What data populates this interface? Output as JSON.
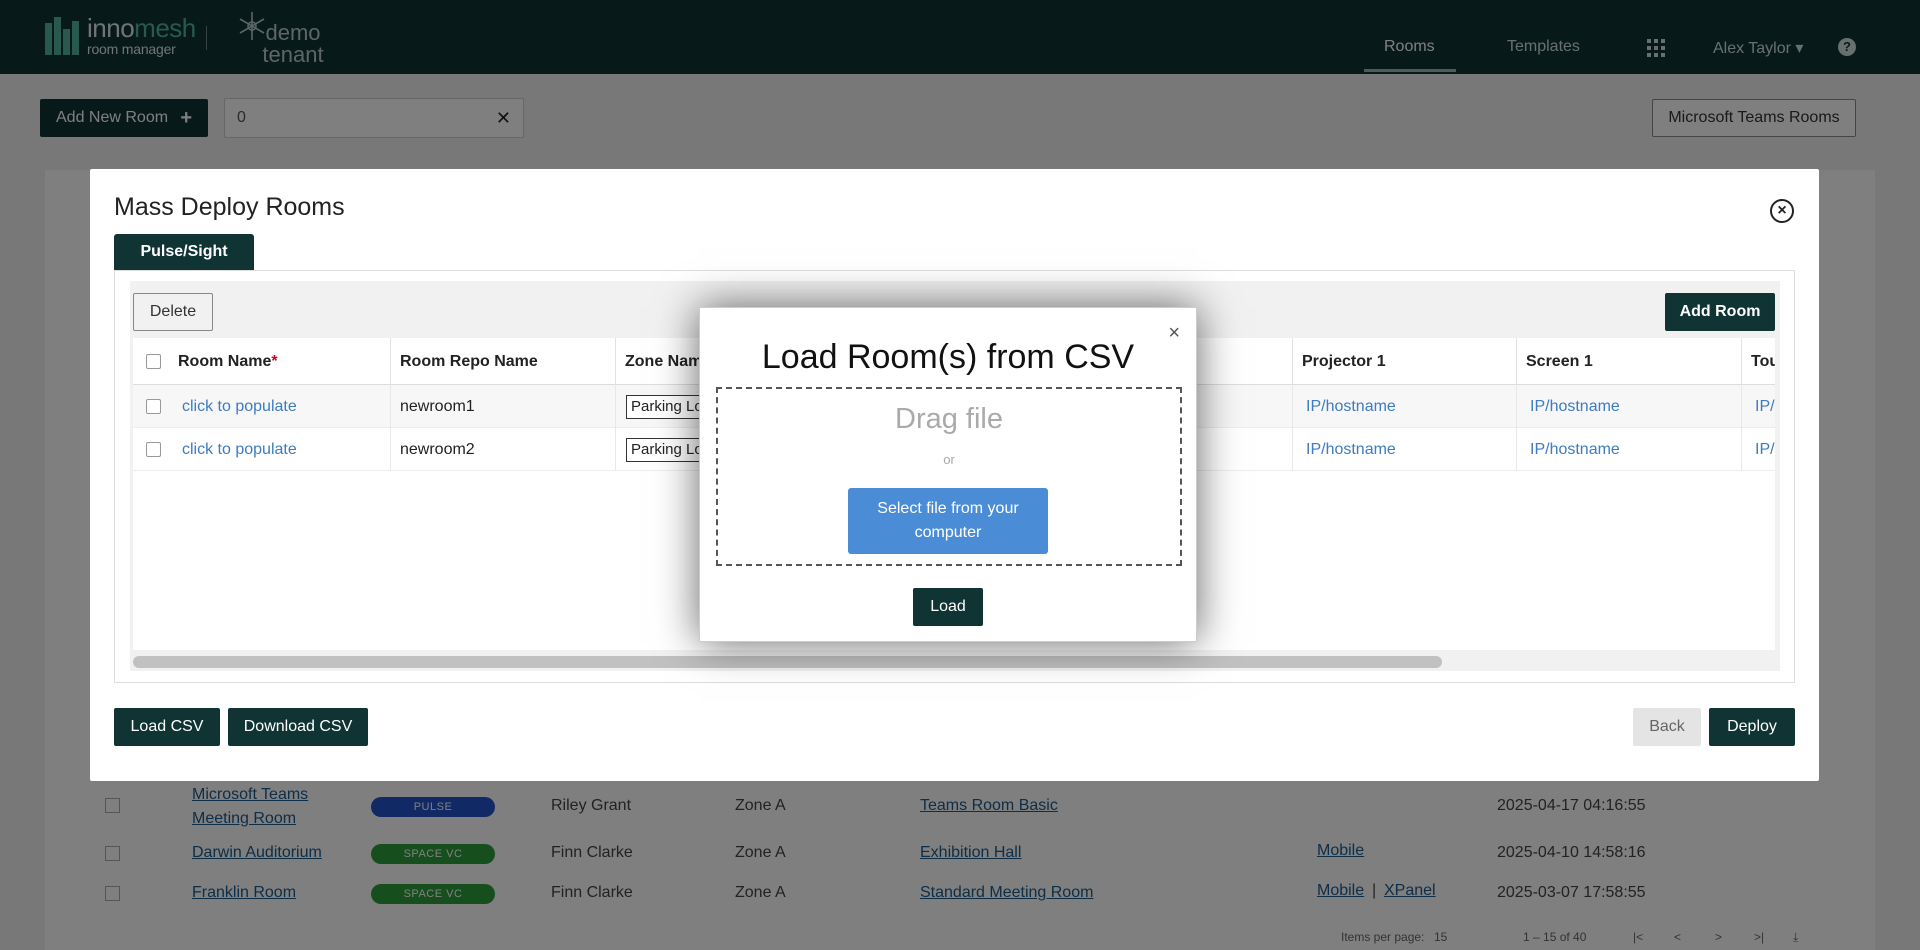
{
  "header": {
    "logo_name_1": "inno",
    "logo_name_2": "mesh",
    "logo_sub": "room manager",
    "tenant": "demo tenant",
    "nav": [
      {
        "label": "Rooms"
      },
      {
        "label": "Templates"
      }
    ],
    "user": "Alex Taylor ▾",
    "help": "?"
  },
  "toolbar": {
    "add_room_label": "Add New Room",
    "search_value": "0",
    "mtr_label": "Microsoft Teams Rooms"
  },
  "background_rows": [
    {
      "name_line1": "Microsoft Teams",
      "name_line2": "Meeting Room",
      "type": "PULSE",
      "owner": "Riley Grant",
      "zone": "Zone A",
      "template": "Teams Room Basic",
      "access": "",
      "access2": "",
      "date": "2025-04-17 04:16:55"
    },
    {
      "name_line1": "Darwin Auditorium",
      "name_line2": "",
      "type": "SPACE VC",
      "owner": "Finn Clarke",
      "zone": "Zone A",
      "template": "Exhibition Hall",
      "access": "Mobile",
      "access2": "",
      "date": "2025-04-10 14:58:16"
    },
    {
      "name_line1": "Franklin Room",
      "name_line2": "",
      "type": "SPACE VC",
      "owner": "Finn Clarke",
      "zone": "Zone A",
      "template": "Standard Meeting Room",
      "access": "Mobile",
      "access2": "XPanel",
      "date": "2025-03-07 17:58:55"
    }
  ],
  "pager": {
    "items_per_page_label": "Items per page:",
    "items_per_page": "15",
    "range": "1 – 15 of 40"
  },
  "modal": {
    "title": "Mass Deploy Rooms",
    "tab": "Pulse/Sight",
    "delete_label": "Delete",
    "add_room_label": "Add Room",
    "columns": [
      "Room Name",
      "Room Repo Name",
      "Zone Name",
      "Projector 1",
      "Screen 1",
      "Touch"
    ],
    "rows": [
      {
        "room_name": "click to populate",
        "repo_name": "newroom1",
        "zone": "Parking Lot",
        "projector": "IP/hostname",
        "screen": "IP/hostname",
        "touch": "IP/"
      },
      {
        "room_name": "click to populate",
        "repo_name": "newroom2",
        "zone": "Parking Lot",
        "projector": "IP/hostname",
        "screen": "IP/hostname",
        "touch": "IP/"
      }
    ],
    "load_csv_label": "Load CSV",
    "download_csv_label": "Download CSV",
    "back_label": "Back",
    "deploy_label": "Deploy"
  },
  "csv_dialog": {
    "title": "Load Room(s) from CSV",
    "drag_text": "Drag file",
    "or_text": "or",
    "select_label": "Select file from your computer",
    "load_label": "Load",
    "close": "×"
  },
  "colors": {
    "brand_dark": "#0f3433",
    "accent_teal": "#4fb39c",
    "link_blue": "#3d7cc0",
    "select_button_blue": "#4a8dd6",
    "pulse_pill": "#2253c9",
    "space_pill": "#2e9c3a"
  }
}
